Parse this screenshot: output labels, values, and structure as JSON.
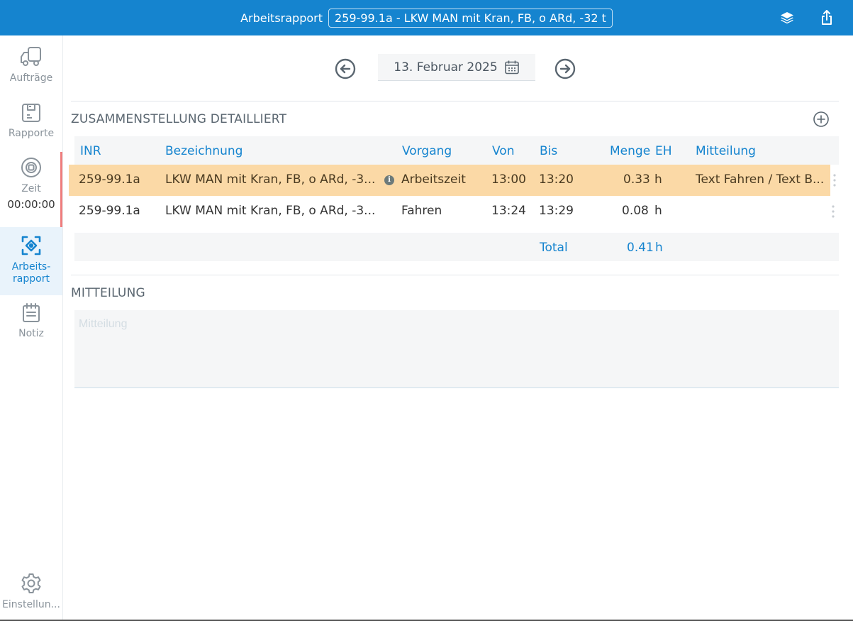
{
  "header": {
    "title_label": "Arbeitsrapport",
    "title_value": "259-99.1a - LKW MAN mit Kran, FB, o ARd, -32 t"
  },
  "sidebar": {
    "items": [
      {
        "label": "Aufträge"
      },
      {
        "label": "Rapporte"
      },
      {
        "label": "Zeit",
        "timer": "00:00:00"
      },
      {
        "label_line1": "Arbeits-",
        "label_line2": "rapport"
      },
      {
        "label": "Notiz"
      },
      {
        "label": "Einstellun..."
      }
    ]
  },
  "date_nav": {
    "date": "13. Februar 2025"
  },
  "summary": {
    "title": "ZUSAMMENSTELLUNG DETAILLIERT",
    "columns": {
      "inr": "INR",
      "bezeichnung": "Bezeichnung",
      "vorgang": "Vorgang",
      "von": "Von",
      "bis": "Bis",
      "menge": "Menge",
      "eh": "EH",
      "mitteilung": "Mitteilung"
    },
    "rows": [
      {
        "inr": "259-99.1a",
        "bezeichnung": "LKW MAN mit Kran, FB, o ARd, -3...",
        "info": "i",
        "vorgang": "Arbeitszeit",
        "von": "13:00",
        "bis": "13:20",
        "menge": "0.33",
        "eh": "h",
        "mitteilung": "Text Fahren / Text B..."
      },
      {
        "inr": "259-99.1a",
        "bezeichnung": "LKW MAN mit Kran, FB, o ARd, -3...",
        "vorgang": "Fahren",
        "von": "13:24",
        "bis": "13:29",
        "menge": "0.08",
        "eh": "h",
        "mitteilung": ""
      }
    ],
    "total_label": "Total",
    "total_value": "0.41",
    "total_unit": "h"
  },
  "message": {
    "title": "MITTEILUNG",
    "placeholder": "Mitteilung",
    "value": ""
  },
  "colors": {
    "accent": "#1584cf",
    "highlight_row": "#fbd9a6",
    "timer_indicator": "#ef7d7d"
  }
}
